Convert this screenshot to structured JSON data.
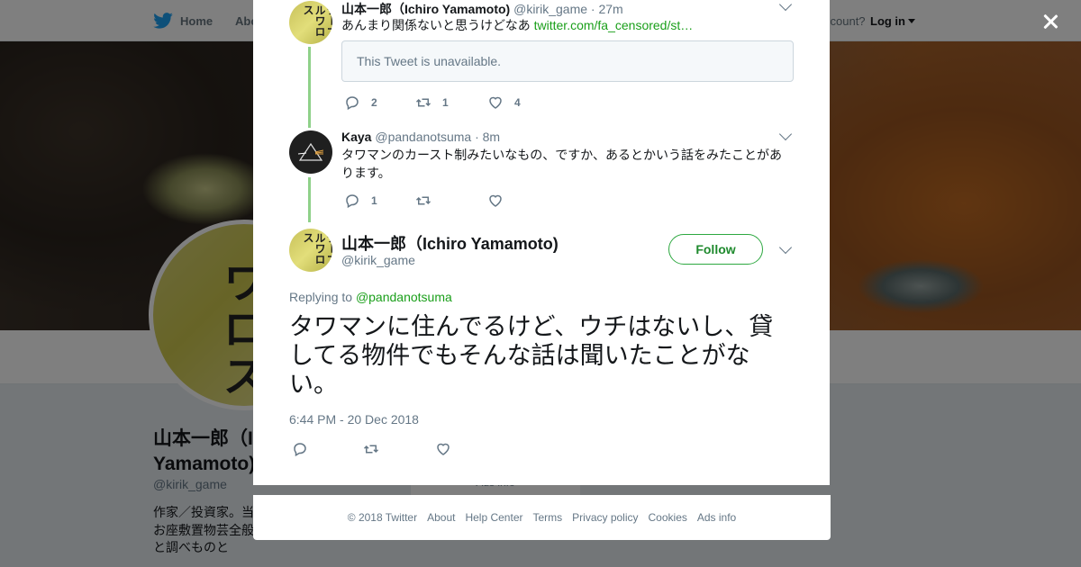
{
  "topnav": {
    "home_label": "Home",
    "about_label": "Abo",
    "account_prompt": "ccount?",
    "login_label": "Log in"
  },
  "profile": {
    "name_line1": "山本一郎（I",
    "name_line2": "Yamamoto)",
    "handle": "@kirik_game",
    "bio": "作家／投資家。当 の意見です。情報 員、お座敷置物芸全般。ゲームと読書と 野球と調べものと",
    "avatar_text": "ワロス",
    "bg_ads_info": "Ads info"
  },
  "thread": [
    {
      "name": "山本一郎（Ichiro Yamamoto)",
      "handle": "@kirik_game",
      "time": "· 27m",
      "text": "あんまり関係ないと思うけどなあ",
      "link": "twitter.com/fa_censored/st…",
      "quoted_unavailable": "This Tweet is unavailable.",
      "avatar_text": "テーブルワロス",
      "replies": "2",
      "retweets": "1",
      "likes": "4"
    },
    {
      "name": "Kaya",
      "handle": "@pandanotsuma",
      "time": "· 8m",
      "text": "タワマンのカースト制みたいなもの、ですか、あるとかいう話をみたことがあります。",
      "replies": "1",
      "retweets": "",
      "likes": ""
    }
  ],
  "main_tweet": {
    "name": "山本一郎（Ichiro Yamamoto)",
    "handle": "@kirik_game",
    "avatar_text": "テーブルワロス",
    "follow_label": "Follow",
    "replying_prefix": "Replying to",
    "replying_to": "@pandanotsuma",
    "text": "タワマンに住んでるけど、ウチはないし、貸してる物件でもそんな話は聞いたことがない。",
    "timestamp": "6:44 PM - 20 Dec 2018"
  },
  "footer": {
    "copyright": "© 2018 Twitter",
    "about": "About",
    "help": "Help Center",
    "terms": "Terms",
    "privacy": "Privacy policy",
    "cookies": "Cookies",
    "ads": "Ads info"
  },
  "colors": {
    "accent_green": "#1a9f1a",
    "thread_line": "#8fd18a",
    "twitter_blue": "#1da1f2"
  }
}
